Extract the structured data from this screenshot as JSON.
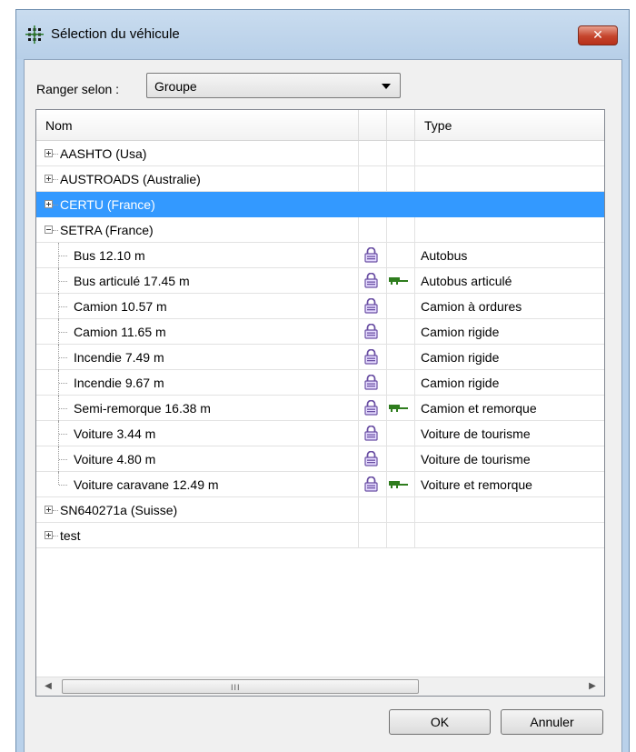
{
  "window": {
    "title": "Sélection du véhicule",
    "close_glyph": "✕"
  },
  "sort": {
    "label": "Ranger selon :",
    "value": "Groupe"
  },
  "columns": {
    "name": "Nom",
    "col2": "",
    "col3": "",
    "type": "Type"
  },
  "rows": [
    {
      "name": "AASHTO (Usa)"
    },
    {
      "name": "AUSTROADS (Australie)"
    },
    {
      "name": "CERTU (France)"
    },
    {
      "name": "SETRA (France)"
    },
    {
      "name": "Bus 12.10 m",
      "type": "Autobus"
    },
    {
      "name": "Bus articulé 17.45 m",
      "type": "Autobus articulé"
    },
    {
      "name": "Camion 10.57 m",
      "type": "Camion à ordures"
    },
    {
      "name": "Camion 11.65 m",
      "type": "Camion rigide"
    },
    {
      "name": "Incendie 7.49 m",
      "type": "Camion rigide"
    },
    {
      "name": "Incendie 9.67 m",
      "type": "Camion rigide"
    },
    {
      "name": "Semi-remorque 16.38 m",
      "type": "Camion et remorque"
    },
    {
      "name": "Voiture 3.44 m",
      "type": "Voiture de tourisme"
    },
    {
      "name": "Voiture 4.80 m",
      "type": "Voiture de tourisme"
    },
    {
      "name": "Voiture caravane 12.49 m",
      "type": "Voiture et remorque"
    },
    {
      "name": "SN640271a (Suisse)"
    },
    {
      "name": "test"
    }
  ],
  "scrollbar": {
    "left": "◀",
    "right": "▶",
    "grip": "III"
  },
  "buttons": {
    "ok": "OK",
    "cancel": "Annuler"
  },
  "colors": {
    "selection": "#3399ff",
    "lock": "#7a5fb0",
    "truck": "#2f7d1e"
  },
  "icons": {
    "app": "grid-icon",
    "lock": "lock-icon",
    "trailer": "trailer-icon"
  }
}
